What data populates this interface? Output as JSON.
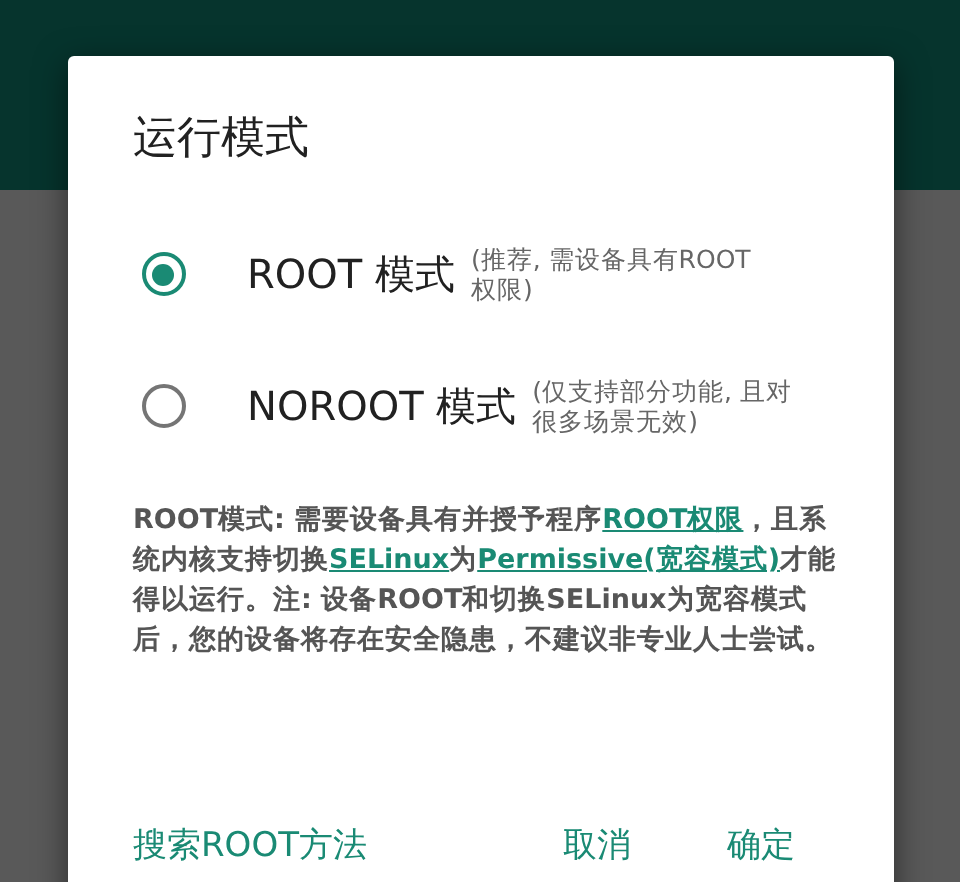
{
  "dialog": {
    "title": "运行模式",
    "options": [
      {
        "label": "ROOT 模式",
        "hint": "(推荐, 需设备具有ROOT权限)",
        "selected": true
      },
      {
        "label": "NOROOT 模式",
        "hint": "(仅支持部分功能, 且对很多场景无效)",
        "selected": false
      }
    ],
    "description": [
      {
        "text": "ROOT模式: 需要设备具有并授予程序",
        "link": false
      },
      {
        "text": "ROOT权限",
        "link": true
      },
      {
        "text": "，且系统内核支持切换",
        "link": false
      },
      {
        "text": "SELinux",
        "link": true
      },
      {
        "text": "为",
        "link": false
      },
      {
        "text": "Permissive(宽容模式)",
        "link": true
      },
      {
        "text": "才能得以运行。注: 设备ROOT和切换SELinux为宽容模式后，您的设备将存在安全隐患，不建议非专业人士尝试。",
        "link": false
      }
    ],
    "buttons": [
      {
        "label": "搜索ROOT方法"
      },
      {
        "label": "取消"
      },
      {
        "label": "确定"
      }
    ]
  }
}
